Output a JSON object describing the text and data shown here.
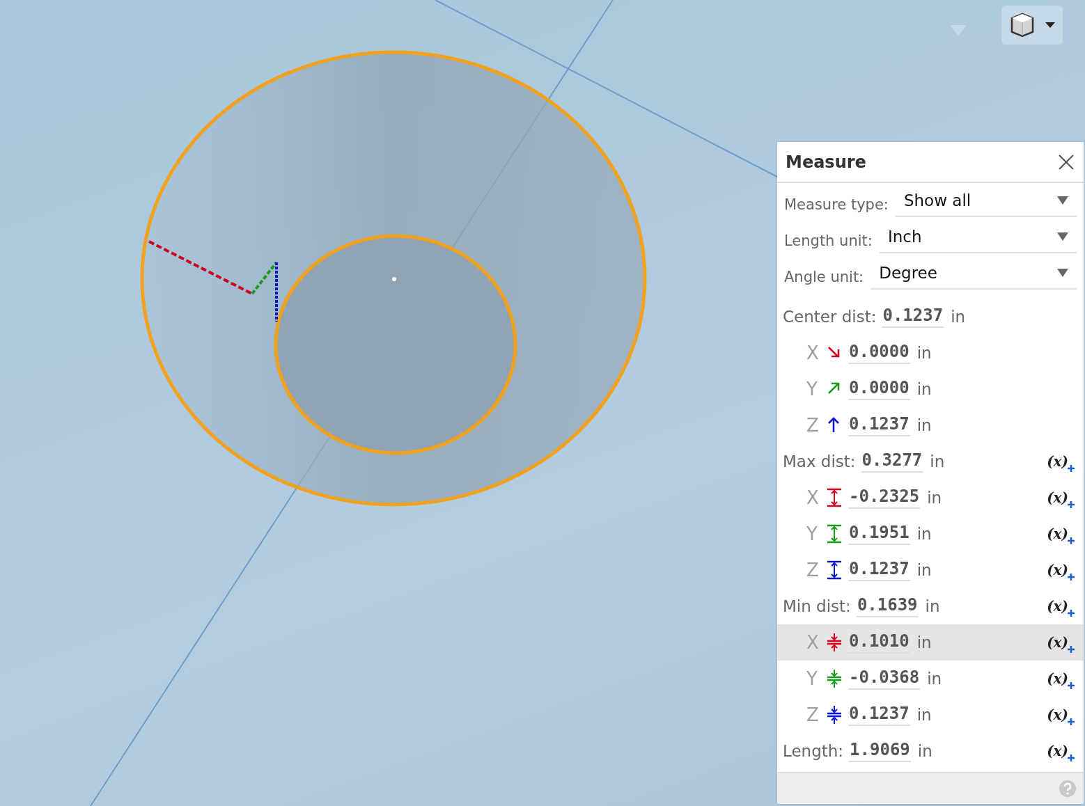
{
  "panel": {
    "title": "Measure",
    "fields": [
      {
        "label": "Measure type:",
        "value": "Show all"
      },
      {
        "label": "Length unit:",
        "value": "Inch"
      },
      {
        "label": "Angle unit:",
        "value": "Degree"
      }
    ],
    "rows": [
      {
        "kind": "total",
        "label": "Center dist:",
        "value": "0.1237",
        "unit": "in",
        "selected": false
      },
      {
        "kind": "offset",
        "axis": "X",
        "color": "#d0021b",
        "value": "0.0000",
        "unit": "in",
        "selected": false
      },
      {
        "kind": "offset",
        "axis": "Y",
        "color": "#1a9a1a",
        "value": "0.0000",
        "unit": "in",
        "selected": false
      },
      {
        "kind": "offset",
        "axis": "Z",
        "color": "#0a14c8",
        "value": "0.1237",
        "unit": "in",
        "selected": false
      },
      {
        "kind": "total",
        "label": "Max dist:",
        "value": "0.3277",
        "unit": "in",
        "variable": "(x)",
        "selected": false
      },
      {
        "kind": "span",
        "axis": "X",
        "color": "#d0021b",
        "value": "-0.2325",
        "unit": "in",
        "variable": "(x)",
        "selected": false
      },
      {
        "kind": "span",
        "axis": "Y",
        "color": "#1a9a1a",
        "value": "0.1951",
        "unit": "in",
        "variable": "(x)",
        "selected": false
      },
      {
        "kind": "span",
        "axis": "Z",
        "color": "#0a14c8",
        "value": "0.1237",
        "unit": "in",
        "variable": "(x)",
        "selected": false
      },
      {
        "kind": "total",
        "label": "Min dist:",
        "value": "0.1639",
        "unit": "in",
        "variable": "(x)",
        "selected": false
      },
      {
        "kind": "gap",
        "axis": "X",
        "color": "#d0021b",
        "value": "0.1010",
        "unit": "in",
        "variable": "(x)",
        "selected": true
      },
      {
        "kind": "gap",
        "axis": "Y",
        "color": "#1a9a1a",
        "value": "-0.0368",
        "unit": "in",
        "variable": "(x)",
        "selected": false
      },
      {
        "kind": "gap",
        "axis": "Z",
        "color": "#0a14c8",
        "value": "0.1237",
        "unit": "in",
        "variable": "(x)",
        "selected": false
      },
      {
        "kind": "total",
        "label": "Length:",
        "value": "1.9069",
        "unit": "in",
        "variable": "(x)",
        "selected": false
      }
    ]
  }
}
